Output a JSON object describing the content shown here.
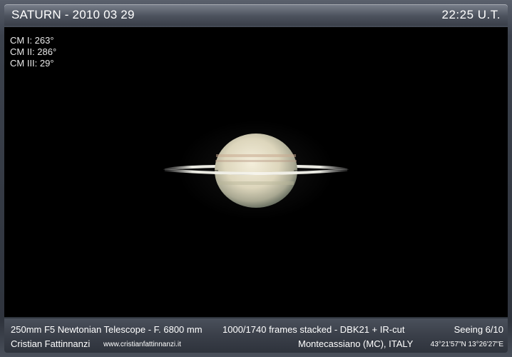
{
  "header": {
    "title": "SATURN - 2010 03 29",
    "time": "22:25  U.T."
  },
  "central_meridians": {
    "cm1": "CM I: 263°",
    "cm2": "CM II: 286°",
    "cm3": "CM III: 29°"
  },
  "footer": {
    "telescope": "250mm F5 Newtonian Telescope - F. 6800 mm",
    "frames": "1000/1740 frames stacked - DBK21 + IR-cut",
    "seeing": "Seeing 6/10",
    "author": "Cristian Fattinnanzi",
    "website": "www.cristianfattinnanzi.it",
    "location": "Montecassiano (MC), ITALY",
    "coordinates": "43°21'57\"N 13°26'27\"E"
  }
}
